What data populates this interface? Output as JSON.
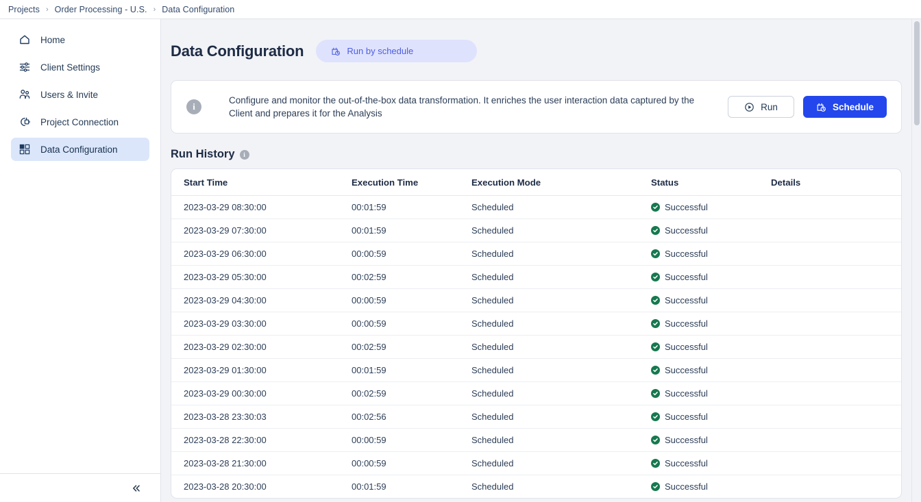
{
  "breadcrumb": {
    "items": [
      {
        "label": "Projects"
      },
      {
        "label": "Order Processing - U.S."
      },
      {
        "label": "Data Configuration"
      }
    ],
    "separator": "›"
  },
  "sidebar": {
    "items": [
      {
        "label": "Home",
        "icon": "home-icon",
        "active": false
      },
      {
        "label": "Client Settings",
        "icon": "sliders-icon",
        "active": false
      },
      {
        "label": "Users & Invite",
        "icon": "users-icon",
        "active": false
      },
      {
        "label": "Project Connection",
        "icon": "plug-icon",
        "active": false
      },
      {
        "label": "Data Configuration",
        "icon": "grid-icon",
        "active": true
      }
    ],
    "collapse_label": "«"
  },
  "header": {
    "title": "Data Configuration",
    "badge_label": "Run by schedule",
    "badge_icon": "calendar-clock-icon"
  },
  "info_card": {
    "icon": "info-icon",
    "icon_glyph": "i",
    "text": "Configure and monitor the out-of-the-box data transformation. It enriches the user interaction data captured by the Client and prepares it for the Analysis",
    "run_label": "Run",
    "run_icon": "play-circle-icon",
    "schedule_label": "Schedule",
    "schedule_icon": "calendar-clock-icon"
  },
  "run_history": {
    "title": "Run History",
    "info_glyph": "i",
    "columns": [
      "Start Time",
      "Execution Time",
      "Execution Mode",
      "Status",
      "Details"
    ],
    "rows": [
      {
        "start": "2023-03-29 08:30:00",
        "exec": "00:01:59",
        "mode": "Scheduled",
        "status": "Successful",
        "details": ""
      },
      {
        "start": "2023-03-29 07:30:00",
        "exec": "00:01:59",
        "mode": "Scheduled",
        "status": "Successful",
        "details": ""
      },
      {
        "start": "2023-03-29 06:30:00",
        "exec": "00:00:59",
        "mode": "Scheduled",
        "status": "Successful",
        "details": ""
      },
      {
        "start": "2023-03-29 05:30:00",
        "exec": "00:02:59",
        "mode": "Scheduled",
        "status": "Successful",
        "details": ""
      },
      {
        "start": "2023-03-29 04:30:00",
        "exec": "00:00:59",
        "mode": "Scheduled",
        "status": "Successful",
        "details": ""
      },
      {
        "start": "2023-03-29 03:30:00",
        "exec": "00:00:59",
        "mode": "Scheduled",
        "status": "Successful",
        "details": ""
      },
      {
        "start": "2023-03-29 02:30:00",
        "exec": "00:02:59",
        "mode": "Scheduled",
        "status": "Successful",
        "details": ""
      },
      {
        "start": "2023-03-29 01:30:00",
        "exec": "00:01:59",
        "mode": "Scheduled",
        "status": "Successful",
        "details": ""
      },
      {
        "start": "2023-03-29 00:30:00",
        "exec": "00:02:59",
        "mode": "Scheduled",
        "status": "Successful",
        "details": ""
      },
      {
        "start": "2023-03-28 23:30:03",
        "exec": "00:02:56",
        "mode": "Scheduled",
        "status": "Successful",
        "details": ""
      },
      {
        "start": "2023-03-28 22:30:00",
        "exec": "00:00:59",
        "mode": "Scheduled",
        "status": "Successful",
        "details": ""
      },
      {
        "start": "2023-03-28 21:30:00",
        "exec": "00:00:59",
        "mode": "Scheduled",
        "status": "Successful",
        "details": ""
      },
      {
        "start": "2023-03-28 20:30:00",
        "exec": "00:01:59",
        "mode": "Scheduled",
        "status": "Successful",
        "details": ""
      }
    ]
  },
  "colors": {
    "accent": "#2347ec",
    "badge_bg": "#dfe2fd",
    "badge_fg": "#4c5ee0",
    "active_nav_bg": "#dbe6fb",
    "success": "#17794f",
    "page_bg": "#f2f3f7",
    "text": "#2c3e57"
  }
}
